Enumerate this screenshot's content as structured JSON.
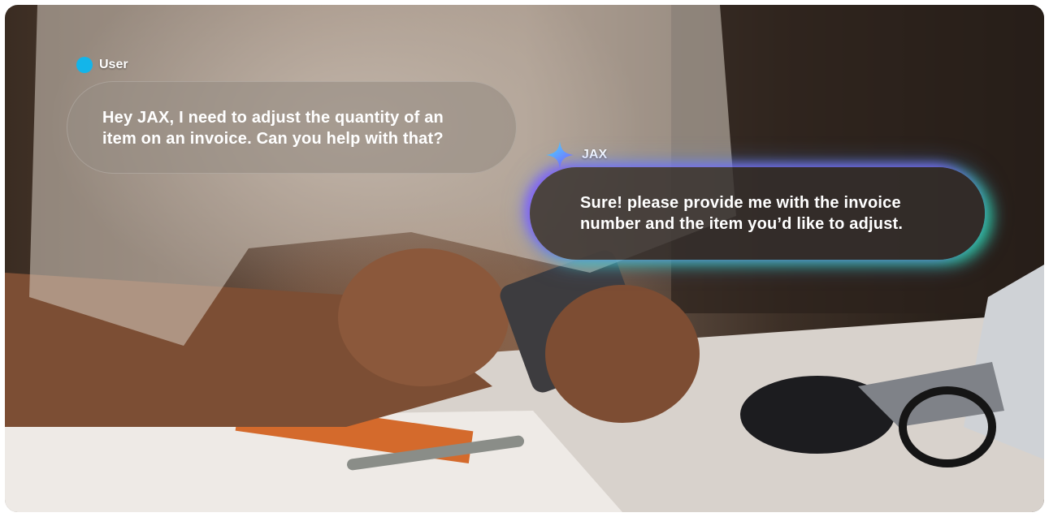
{
  "conversation": {
    "user": {
      "name": "User",
      "icon": "dot-icon",
      "message": "Hey JAX, I need to adjust the quantity of an item on an invoice. Can you help with that?"
    },
    "assistant": {
      "name": "JAX",
      "icon": "sparkle-icon",
      "message": "Sure! please provide me with the invoice number and the item you’d like to adjust."
    }
  },
  "colors": {
    "user_dot": "#13b5ea",
    "assistant_glow_purple": "#825aff",
    "assistant_glow_teal": "#28e6aa",
    "text": "#ffffff"
  }
}
